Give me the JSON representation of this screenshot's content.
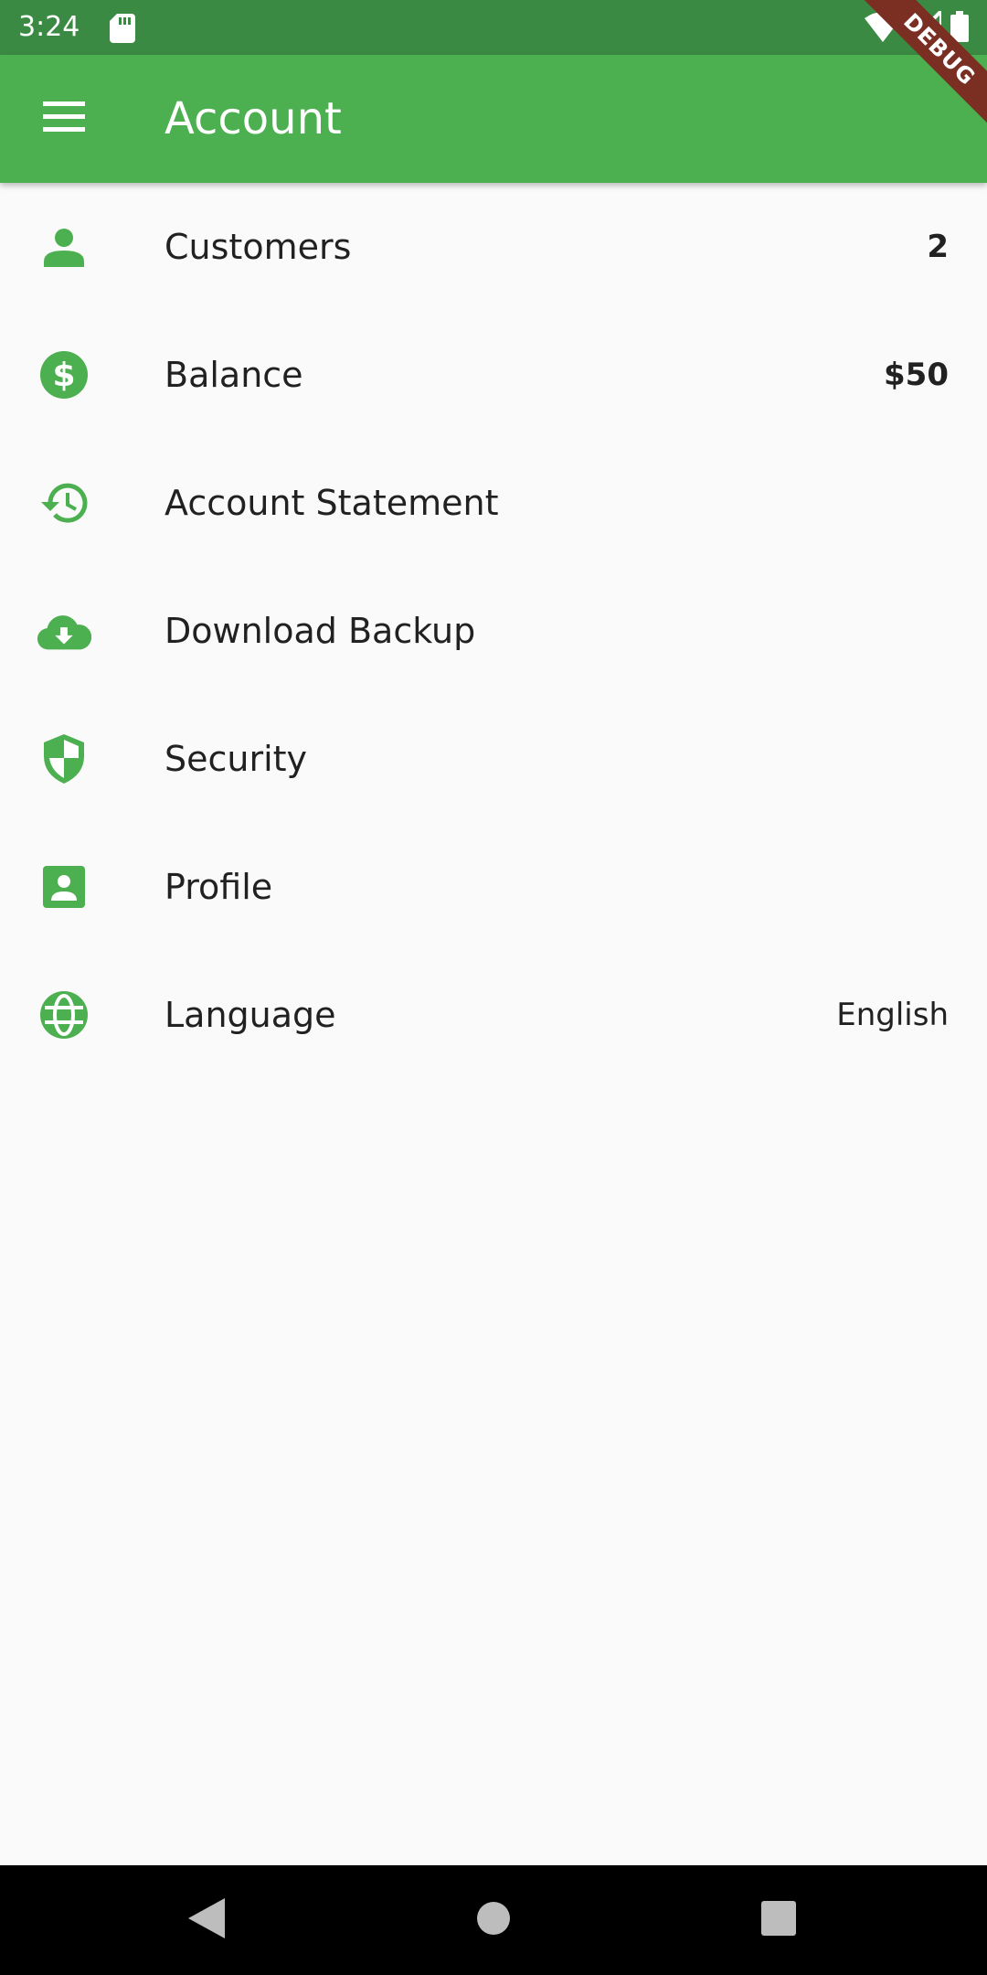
{
  "status_bar": {
    "time": "3:24",
    "icons": [
      "sd-card-icon",
      "wifi-icon",
      "signal-icon",
      "battery-icon"
    ]
  },
  "app_bar": {
    "title": "Account",
    "menu_icon": "menu-icon",
    "background_color": "#4caf50",
    "debug_label": "DEBUG"
  },
  "colors": {
    "accent": "#4caf50",
    "status_bar": "#3b8a43",
    "text": "#212121"
  },
  "items": [
    {
      "icon": "person-icon",
      "label": "Customers",
      "trailing": "2"
    },
    {
      "icon": "dollar-circle-icon",
      "label": "Balance",
      "trailing": "$50"
    },
    {
      "icon": "history-icon",
      "label": "Account Statement",
      "trailing": ""
    },
    {
      "icon": "cloud-download-icon",
      "label": "Download Backup",
      "trailing": ""
    },
    {
      "icon": "shield-icon",
      "label": "Security",
      "trailing": ""
    },
    {
      "icon": "account-box-icon",
      "label": "Profile",
      "trailing": ""
    },
    {
      "icon": "globe-icon",
      "label": "Language",
      "trailing": "English"
    }
  ],
  "nav_bar": {
    "buttons": [
      "back-icon",
      "home-icon",
      "recents-icon"
    ]
  }
}
